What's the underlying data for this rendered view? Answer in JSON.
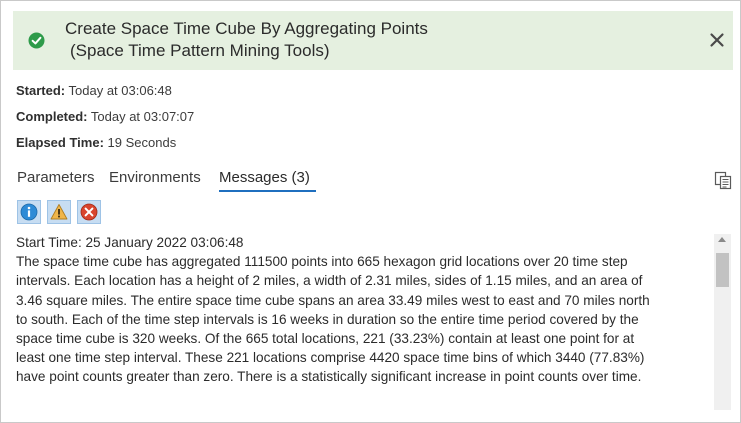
{
  "header": {
    "title_line1": "Create Space Time Cube By Aggregating Points",
    "title_line2": "(Space Time Pattern Mining Tools)",
    "status_icon": "check-circle-icon",
    "close_icon": "close-icon",
    "accent_color": "#e5f0e0"
  },
  "meta": {
    "started_label": "Started:",
    "started_value": "Today at 03:06:48",
    "completed_label": "Completed:",
    "completed_value": "Today at 03:07:07",
    "elapsed_label": "Elapsed Time:",
    "elapsed_value": "19 Seconds"
  },
  "tabs": [
    {
      "label": "Parameters",
      "active": false
    },
    {
      "label": "Environments",
      "active": false
    },
    {
      "label": "Messages (3)",
      "active": true
    }
  ],
  "filters": [
    {
      "icon": "info-icon",
      "color": "#2e8bd6"
    },
    {
      "icon": "warning-icon",
      "color": "#e8a93a"
    },
    {
      "icon": "error-icon",
      "color": "#d9452e"
    }
  ],
  "messages": {
    "start_time": "Start Time: 25 January 2022 03:06:48",
    "lines": [
      "The space time cube has aggregated 111500 points into 665 hexagon grid locations over 20 time step",
      "intervals. Each location has a height of 2 miles, a width of 2.31 miles, sides of 1.15 miles, and an area of",
      "3.46 square miles. The entire space time cube spans an area 33.49 miles west to east and 70 miles north",
      "to south. Each of the time step intervals is 16 weeks in duration so the entire time period covered by the",
      "space time cube is 320 weeks. Of the 665 total locations, 221 (33.23%) contain at least one point for at",
      "least one time step interval. These 221 locations comprise 4420 space time bins of which 3440 (77.83%)",
      "have point counts greater than zero. There is a statistically significant increase in point counts over time."
    ]
  },
  "colors": {
    "tab_underline": "#1f6fbf",
    "success": "#2e9b4a"
  }
}
